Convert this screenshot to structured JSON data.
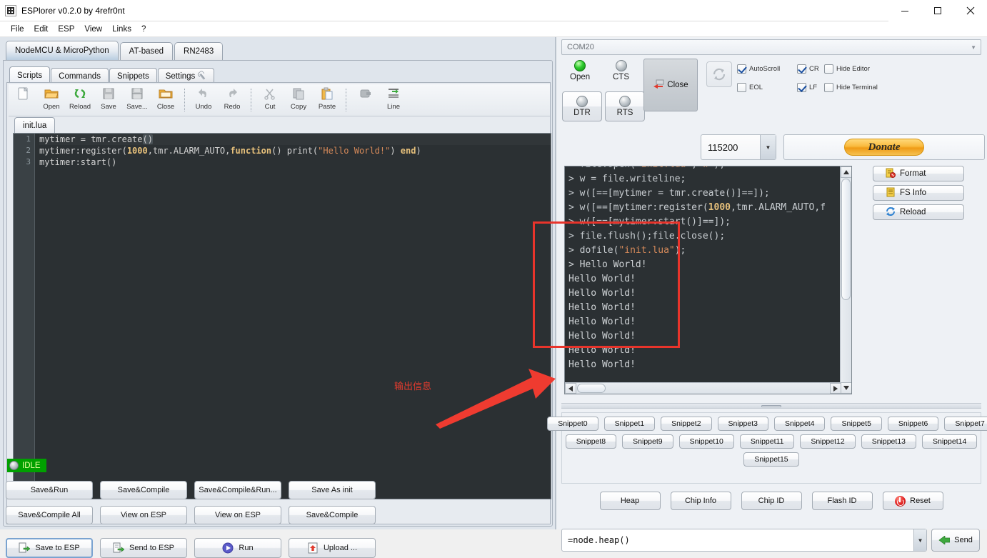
{
  "window": {
    "title": "ESPlorer v0.2.0 by 4refr0nt",
    "icon": "app-icon",
    "controls": {
      "minimize": "—",
      "maximize": "□",
      "close": "✕"
    }
  },
  "menubar": {
    "items": [
      "File",
      "Edit",
      "ESP",
      "View",
      "Links",
      "?"
    ]
  },
  "left": {
    "outer_tabs": [
      {
        "label": "NodeMCU & MicroPython",
        "active": true
      },
      {
        "label": "AT-based",
        "active": false
      },
      {
        "label": "RN2483",
        "active": false
      }
    ],
    "inner_tabs": [
      {
        "label": "Scripts",
        "active": true,
        "icon": ""
      },
      {
        "label": "Commands",
        "active": false,
        "icon": ""
      },
      {
        "label": "Snippets",
        "active": false,
        "icon": ""
      },
      {
        "label": "Settings",
        "active": false,
        "icon": "wrench-icon"
      }
    ],
    "toolbar": [
      {
        "label": "",
        "icon": "new-file-icon"
      },
      {
        "label": "Open",
        "icon": "open-folder-icon"
      },
      {
        "label": "Reload",
        "icon": "reload-icon"
      },
      {
        "label": "Save",
        "icon": "save-icon"
      },
      {
        "label": "Save...",
        "icon": "save-as-icon"
      },
      {
        "label": "Close",
        "icon": "close-folder-icon"
      },
      {
        "label": "Undo",
        "icon": "undo-icon"
      },
      {
        "label": "Redo",
        "icon": "redo-icon"
      },
      {
        "label": "Cut",
        "icon": "scissors-icon"
      },
      {
        "label": "Copy",
        "icon": "copy-icon"
      },
      {
        "label": "Paste",
        "icon": "paste-icon"
      },
      {
        "label": "",
        "icon": "comment-icon"
      },
      {
        "label": "Line",
        "icon": "line-icon"
      }
    ],
    "file_tabs": [
      {
        "label": "init.lua",
        "active": true
      }
    ],
    "editor": {
      "lines": [
        {
          "num": "1",
          "text": "mytimer = tmr.create()"
        },
        {
          "num": "2",
          "text": "mytimer:register(1000,tmr.ALARM_AUTO,function() print(\"Hello World!\") end)"
        },
        {
          "num": "3",
          "text": "mytimer:start()"
        }
      ]
    },
    "status": {
      "label": "IDLE",
      "led": "idle-led"
    },
    "buttons_row1": [
      "Save&Run",
      "Save&Compile",
      "Save&Compile&Run...",
      "Save As init"
    ],
    "buttons_row2": [
      "Save&Compile All",
      "View on ESP",
      "View on ESP",
      "Save&Compile"
    ],
    "buttons_row3": [
      {
        "label": "Save to ESP",
        "icon": "save-to-esp-icon",
        "focused": true
      },
      {
        "label": "Send to ESP",
        "icon": "send-to-esp-icon",
        "focused": false
      },
      {
        "label": "Run",
        "icon": "run-icon",
        "focused": false
      },
      {
        "label": "Upload ...",
        "icon": "upload-icon",
        "focused": false
      }
    ]
  },
  "annotation": {
    "text": "输出信息",
    "color": "#e8342b"
  },
  "right": {
    "com_port": {
      "value": "COM20",
      "arrow": "▼"
    },
    "leds": [
      {
        "label": "Open",
        "state": "on"
      },
      {
        "label": "CTS",
        "state": "off"
      },
      {
        "label": "DTR",
        "state": "off"
      },
      {
        "label": "RTS",
        "state": "off"
      }
    ],
    "close_button": {
      "label": "Close",
      "icon": "disconnect-icon"
    },
    "refresh_button": {
      "icon": "refresh-icon"
    },
    "checkboxes": [
      {
        "label": "AutoScroll",
        "checked": true
      },
      {
        "label": "EOL",
        "checked": false
      },
      {
        "label": "CR",
        "checked": true
      },
      {
        "label": "LF",
        "checked": true
      },
      {
        "label": "Hide Editor",
        "checked": false
      },
      {
        "label": "Hide Terminal",
        "checked": false
      }
    ],
    "baudrate": {
      "value": "115200",
      "arrow": "▼"
    },
    "donate": {
      "label": "Donate"
    },
    "terminal": {
      "lines": [
        {
          "segments": [
            {
              "t": "> file.open(",
              "c": "prompt"
            },
            {
              "t": "\"init.lua\"",
              "c": "str"
            },
            {
              "t": ",",
              "c": "prompt"
            },
            {
              "t": "\"w\"",
              "c": "str"
            },
            {
              "t": ");",
              "c": "prompt"
            }
          ]
        },
        {
          "segments": [
            {
              "t": "> w = file.writeline;",
              "c": "prompt"
            }
          ]
        },
        {
          "segments": [
            {
              "t": "> w([==[mytimer = tmr.create()]==]);",
              "c": "prompt"
            }
          ]
        },
        {
          "segments": [
            {
              "t": "> w([==[mytimer:register(",
              "c": "prompt"
            },
            {
              "t": "1000",
              "c": "num"
            },
            {
              "t": ",tmr.ALARM_AUTO,f",
              "c": "prompt"
            }
          ]
        },
        {
          "segments": [
            {
              "t": "> w([==[mytimer:start()]==]);",
              "c": "prompt"
            }
          ]
        },
        {
          "segments": [
            {
              "t": "> file.flush();file.close();",
              "c": "prompt"
            }
          ]
        },
        {
          "segments": [
            {
              "t": "> dofile(",
              "c": "prompt"
            },
            {
              "t": "\"init.lua\"",
              "c": "str"
            },
            {
              "t": ");",
              "c": "prompt"
            }
          ]
        },
        {
          "segments": [
            {
              "t": "> Hello World!",
              "c": "plain"
            }
          ]
        },
        {
          "segments": [
            {
              "t": "Hello World!",
              "c": "plain"
            }
          ]
        },
        {
          "segments": [
            {
              "t": "Hello World!",
              "c": "plain"
            }
          ]
        },
        {
          "segments": [
            {
              "t": "Hello World!",
              "c": "plain"
            }
          ]
        },
        {
          "segments": [
            {
              "t": "Hello World!",
              "c": "plain"
            }
          ]
        },
        {
          "segments": [
            {
              "t": "Hello World!",
              "c": "plain"
            }
          ]
        },
        {
          "segments": [
            {
              "t": "Hello World!",
              "c": "plain"
            }
          ]
        },
        {
          "segments": [
            {
              "t": "Hello World!",
              "c": "plain"
            }
          ]
        }
      ]
    },
    "side_buttons": [
      {
        "label": "Format",
        "icon": "format-icon"
      },
      {
        "label": "FS Info",
        "icon": "fs-info-icon"
      },
      {
        "label": "Reload",
        "icon": "reload-blue-icon"
      }
    ],
    "snippets": {
      "row1": [
        "Snippet0",
        "Snippet1",
        "Snippet2",
        "Snippet3",
        "Snippet4",
        "Snippet5",
        "Snippet6",
        "Snippet7"
      ],
      "row2": [
        "Snippet8",
        "Snippet9",
        "Snippet10",
        "Snippet11",
        "Snippet12",
        "Snippet13",
        "Snippet14"
      ],
      "row3": [
        "Snippet15"
      ]
    },
    "chip_buttons": [
      {
        "label": "Heap",
        "icon": ""
      },
      {
        "label": "Chip Info",
        "icon": ""
      },
      {
        "label": "Chip ID",
        "icon": ""
      },
      {
        "label": "Flash ID",
        "icon": ""
      },
      {
        "label": "Reset",
        "icon": "power-icon"
      }
    ],
    "command": {
      "value": "=node.heap()",
      "arrow": "▼",
      "send_label": "Send",
      "send_icon": "send-arrow-icon"
    }
  }
}
